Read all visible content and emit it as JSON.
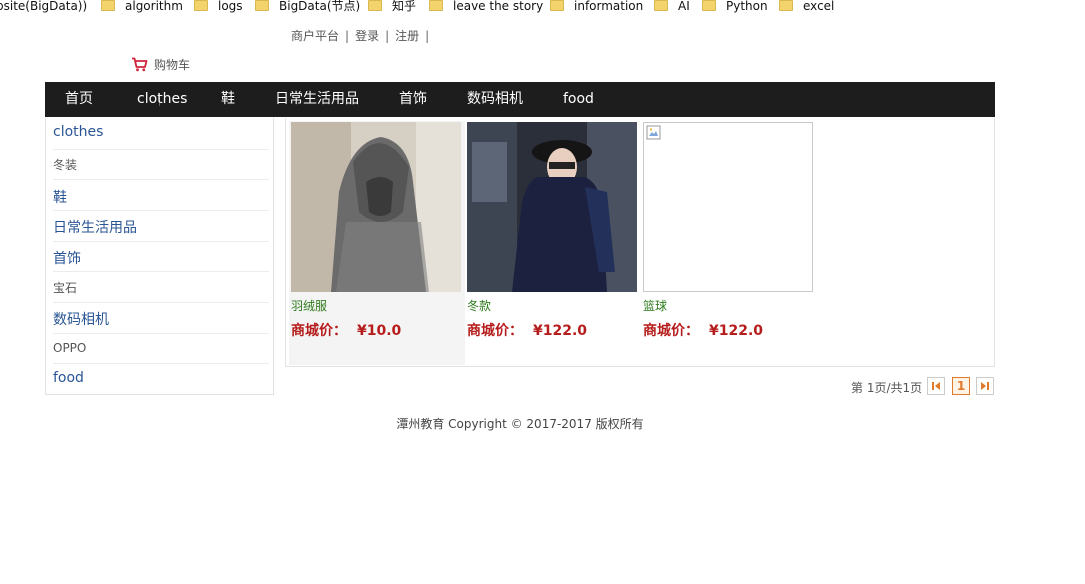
{
  "bookmarks": [
    {
      "label": "bsite(BigData))",
      "folder": false
    },
    {
      "label": "algorithm",
      "folder": true
    },
    {
      "label": "logs",
      "folder": true
    },
    {
      "label": "BigData(节点)",
      "folder": true
    },
    {
      "label": "知乎",
      "folder": true
    },
    {
      "label": "leave the story",
      "folder": true
    },
    {
      "label": "information",
      "folder": true
    },
    {
      "label": "AI",
      "folder": true
    },
    {
      "label": "Python",
      "folder": true
    },
    {
      "label": "excel",
      "folder": true
    }
  ],
  "top_links": {
    "merchant": "商户平台",
    "login": "登录",
    "register": "注册",
    "separator": "|"
  },
  "cart": {
    "label": "购物车"
  },
  "nav": [
    "首页",
    "clothes",
    "鞋",
    "日常生活用品",
    "首饰",
    "数码相机",
    "food"
  ],
  "sidebar": [
    {
      "label": "clothes",
      "kind": "category"
    },
    {
      "label": "冬装",
      "kind": "sub"
    },
    {
      "label": "鞋",
      "kind": "category"
    },
    {
      "label": "日常生活用品",
      "kind": "category"
    },
    {
      "label": "首饰",
      "kind": "category"
    },
    {
      "label": "宝石",
      "kind": "sub"
    },
    {
      "label": "数码相机",
      "kind": "category"
    },
    {
      "label": "OPPO",
      "kind": "sub"
    },
    {
      "label": "food",
      "kind": "category"
    }
  ],
  "products": [
    {
      "name": "羽绒服",
      "price_label": "商城价：",
      "price": "¥10.0",
      "image": "grey-knit-cardigan-photo"
    },
    {
      "name": "冬款",
      "price_label": "商城价：",
      "price": "¥122.0",
      "image": "navy-coat-photo"
    },
    {
      "name": "篮球",
      "price_label": "商城价：",
      "price": "¥122.0",
      "image": "broken-image"
    }
  ],
  "pagination": {
    "info": "第 1页/共1页",
    "current": "1"
  },
  "footer": "潭州教育 Copyright © 2017-2017 版权所有",
  "colors": {
    "nav_bg": "#1d1d1d",
    "category_link": "#2a5594",
    "product_name": "#2c7a1a",
    "price": "#b71c1c",
    "pager_accent": "#e07a2a"
  }
}
